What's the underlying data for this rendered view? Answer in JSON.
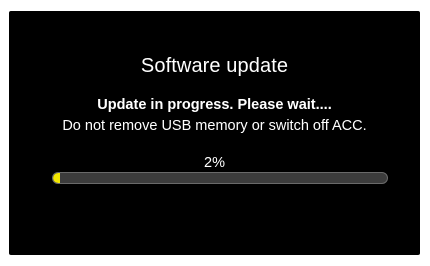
{
  "dialog": {
    "title": "Software update",
    "status_text": "Update in progress. Please wait....",
    "warning_text": "Do not remove USB memory or switch off ACC.",
    "progress_label": "2%",
    "progress_value": 0.02
  },
  "colors": {
    "background": "#000000",
    "text": "#ffffff",
    "progress_fill": "#f2e600",
    "progress_track": "#3c3c3c"
  }
}
